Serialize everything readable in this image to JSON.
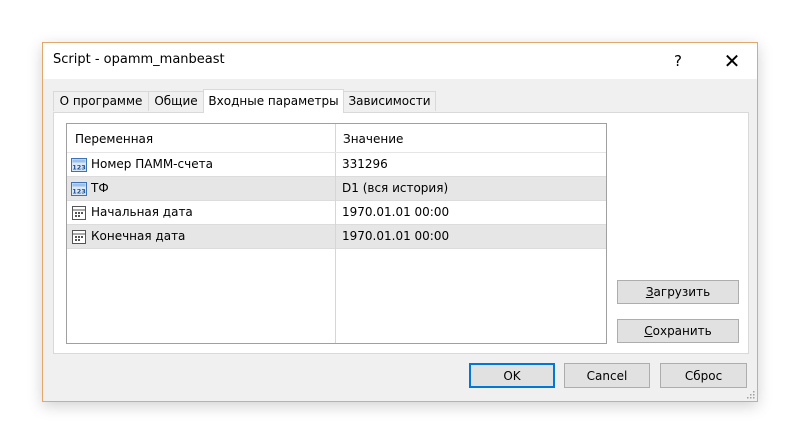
{
  "window": {
    "title": "Script - opamm_manbeast",
    "help_glyph": "?",
    "close_glyph": "✕"
  },
  "tabs": [
    {
      "label": "О программе",
      "active": false
    },
    {
      "label": "Общие",
      "active": false
    },
    {
      "label": "Входные параметры",
      "active": true
    },
    {
      "label": "Зависимости",
      "active": false
    }
  ],
  "grid": {
    "columns": [
      "Переменная",
      "Значение"
    ],
    "rows": [
      {
        "icon": "number-123-icon",
        "name": "Номер ПАММ-счета",
        "value": "331296"
      },
      {
        "icon": "number-123-icon",
        "name": "ТФ",
        "value": "D1 (вся история)"
      },
      {
        "icon": "date-icon",
        "name": "Начальная дата",
        "value": "1970.01.01 00:00"
      },
      {
        "icon": "date-icon",
        "name": "Конечная дата",
        "value": "1970.01.01 00:00"
      }
    ]
  },
  "side_buttons": {
    "load": {
      "accel": "З",
      "rest": "агрузить"
    },
    "save": {
      "accel": "С",
      "rest": "охранить"
    }
  },
  "buttons": {
    "ok": "OK",
    "cancel": "Cancel",
    "reset": "Сброс"
  },
  "colors": {
    "window_border": "#e3a76a",
    "default_button_border": "#0078d7",
    "icon_blue": "#3b73b9"
  }
}
